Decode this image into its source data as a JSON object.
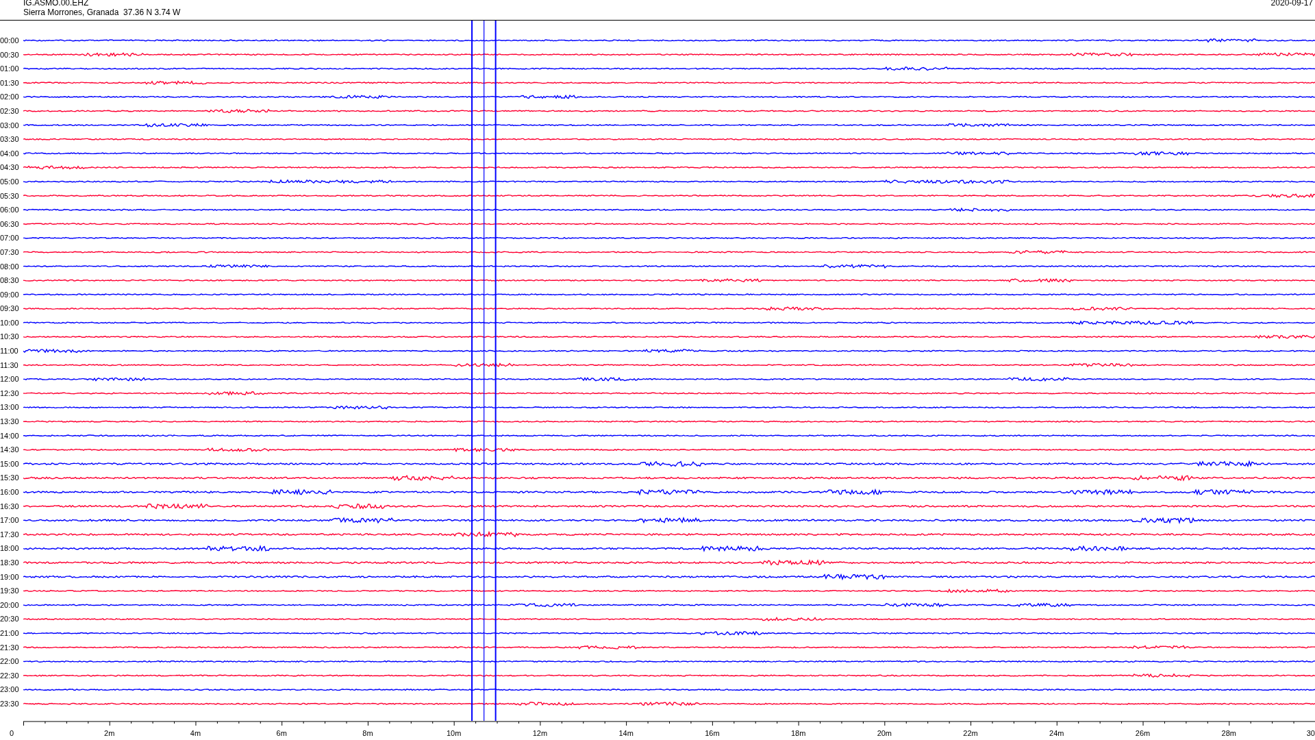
{
  "header": {
    "station": "IG.ASMO.00.EHZ",
    "location": "Sierra Morrones, Granada  37.36 N 3.74 W",
    "date": "2020-09-17"
  },
  "traces": [
    {
      "time": "00:00",
      "color": "#0000ff"
    },
    {
      "time": "00:30",
      "color": "#ff0033"
    },
    {
      "time": "01:00",
      "color": "#0000ff"
    },
    {
      "time": "01:30",
      "color": "#ff0033"
    },
    {
      "time": "02:00",
      "color": "#0000ff"
    },
    {
      "time": "02:30",
      "color": "#ff0033"
    },
    {
      "time": "03:00",
      "color": "#0000ff"
    },
    {
      "time": "03:30",
      "color": "#ff0033"
    },
    {
      "time": "04:00",
      "color": "#0000ff"
    },
    {
      "time": "04:30",
      "color": "#ff0033"
    },
    {
      "time": "05:00",
      "color": "#0000ff"
    },
    {
      "time": "05:30",
      "color": "#ff0033"
    },
    {
      "time": "06:00",
      "color": "#0000ff"
    },
    {
      "time": "06:30",
      "color": "#ff0033"
    },
    {
      "time": "07:00",
      "color": "#0000ff"
    },
    {
      "time": "07:30",
      "color": "#ff0033"
    },
    {
      "time": "08:00",
      "color": "#0000ff"
    },
    {
      "time": "08:30",
      "color": "#ff0033"
    },
    {
      "time": "09:00",
      "color": "#0000ff"
    },
    {
      "time": "09:30",
      "color": "#ff0033"
    },
    {
      "time": "10:00",
      "color": "#0000ff"
    },
    {
      "time": "10:30",
      "color": "#ff0033"
    },
    {
      "time": "11:00",
      "color": "#0000ff"
    },
    {
      "time": "11:30",
      "color": "#ff0033"
    },
    {
      "time": "12:00",
      "color": "#0000ff"
    },
    {
      "time": "12:30",
      "color": "#ff0033"
    },
    {
      "time": "13:00",
      "color": "#0000ff"
    },
    {
      "time": "13:30",
      "color": "#ff0033"
    },
    {
      "time": "14:00",
      "color": "#0000ff"
    },
    {
      "time": "14:30",
      "color": "#ff0033"
    },
    {
      "time": "15:00",
      "color": "#0000ff"
    },
    {
      "time": "15:30",
      "color": "#ff0033"
    },
    {
      "time": "16:00",
      "color": "#0000ff"
    },
    {
      "time": "16:30",
      "color": "#ff0033"
    },
    {
      "time": "17:00",
      "color": "#0000ff"
    },
    {
      "time": "17:30",
      "color": "#ff0033"
    },
    {
      "time": "18:00",
      "color": "#0000ff"
    },
    {
      "time": "18:30",
      "color": "#ff0033"
    },
    {
      "time": "19:00",
      "color": "#0000ff"
    },
    {
      "time": "19:30",
      "color": "#ff0033"
    },
    {
      "time": "20:00",
      "color": "#0000ff"
    },
    {
      "time": "20:30",
      "color": "#ff0033"
    },
    {
      "time": "21:00",
      "color": "#0000ff"
    },
    {
      "time": "21:30",
      "color": "#ff0033"
    },
    {
      "time": "22:00",
      "color": "#0000ff"
    },
    {
      "time": "22:30",
      "color": "#ff0033"
    },
    {
      "time": "23:00",
      "color": "#0000ff"
    },
    {
      "time": "23:30",
      "color": "#ff0033"
    }
  ],
  "x_axis": {
    "ticks": [
      "0",
      "2m",
      "4m",
      "6m",
      "8m",
      "10m",
      "12m",
      "14m",
      "16m",
      "18m",
      "20m",
      "22m",
      "24m",
      "26m",
      "28m",
      "30"
    ]
  }
}
